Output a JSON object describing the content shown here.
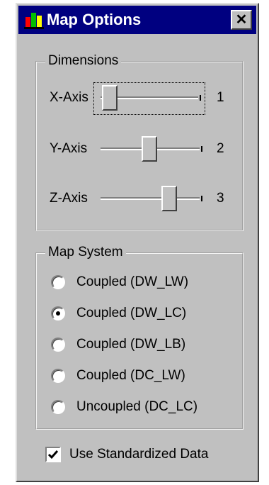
{
  "window": {
    "title": "Map Options",
    "close_label": "✕",
    "accent_color": "#000080",
    "face_color": "#c0c0c0"
  },
  "dimensions": {
    "legend": "Dimensions",
    "sliders": [
      {
        "label": "X-Axis",
        "value": "1",
        "position": 1,
        "min": 1,
        "max": 3
      },
      {
        "label": "Y-Axis",
        "value": "2",
        "position": 2,
        "min": 1,
        "max": 3
      },
      {
        "label": "Z-Axis",
        "value": "3",
        "position": 3,
        "min": 1,
        "max": 3
      }
    ]
  },
  "map_system": {
    "legend": "Map System",
    "options": [
      {
        "label": "Coupled (DW_LW)",
        "selected": false
      },
      {
        "label": "Coupled (DW_LC)",
        "selected": true
      },
      {
        "label": "Coupled (DW_LB)",
        "selected": false
      },
      {
        "label": "Coupled (DC_LW)",
        "selected": false
      },
      {
        "label": "Uncoupled (DC_LC)",
        "selected": false
      }
    ]
  },
  "options": {
    "standardized_label": "Use Standardized Data",
    "standardized_checked": true
  },
  "icons": {
    "app": "map-app-icon",
    "close": "close-icon",
    "check": "checkmark-icon"
  }
}
